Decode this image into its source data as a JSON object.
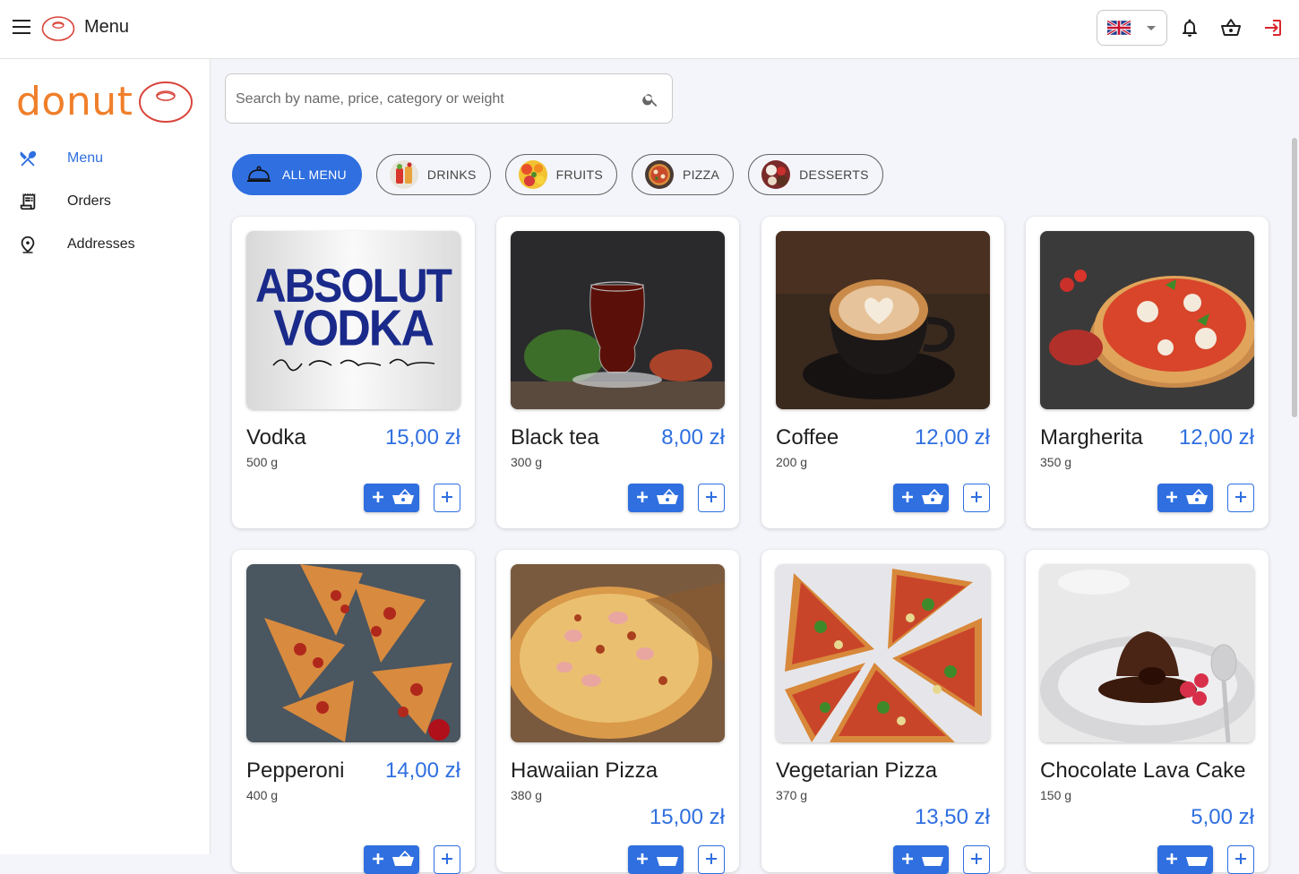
{
  "topbar": {
    "title": "Menu",
    "language_flag": "uk-flag",
    "icons": [
      "hamburger-icon",
      "bell-icon",
      "basket-icon",
      "logout-icon"
    ]
  },
  "sidebar": {
    "brand": "donut",
    "items": [
      {
        "label": "Menu",
        "icon": "fork-knife-icon",
        "active": true
      },
      {
        "label": "Orders",
        "icon": "receipt-icon",
        "active": false
      },
      {
        "label": "Addresses",
        "icon": "location-pin-icon",
        "active": false
      }
    ]
  },
  "search": {
    "placeholder": "Search by name, price, category or weight"
  },
  "categories": [
    {
      "label": "ALL MENU",
      "active": true
    },
    {
      "label": "DRINKS",
      "active": false
    },
    {
      "label": "FRUITS",
      "active": false
    },
    {
      "label": "PIZZA",
      "active": false
    },
    {
      "label": "DESSERTS",
      "active": false
    }
  ],
  "products": [
    {
      "name": "Vodka",
      "price": "15,00 zł",
      "weight": "500 g"
    },
    {
      "name": "Black tea",
      "price": "8,00 zł",
      "weight": "300 g"
    },
    {
      "name": "Coffee",
      "price": "12,00 zł",
      "weight": "200 g"
    },
    {
      "name": "Margherita",
      "price": "12,00 zł",
      "weight": "350 g"
    },
    {
      "name": "Pepperoni",
      "price": "14,00 zł",
      "weight": "400 g"
    },
    {
      "name": "Hawaiian Pizza",
      "price": "15,00 zł",
      "weight": "380 g"
    },
    {
      "name": "Vegetarian Pizza",
      "price": "13,50 zł",
      "weight": "370 g"
    },
    {
      "name": "Chocolate Lava Cake",
      "price": "5,00 zł",
      "weight": "150 g"
    }
  ],
  "colors": {
    "accent": "#2f6fe0",
    "brand": "#f07f2a",
    "logout": "#d9262c"
  }
}
